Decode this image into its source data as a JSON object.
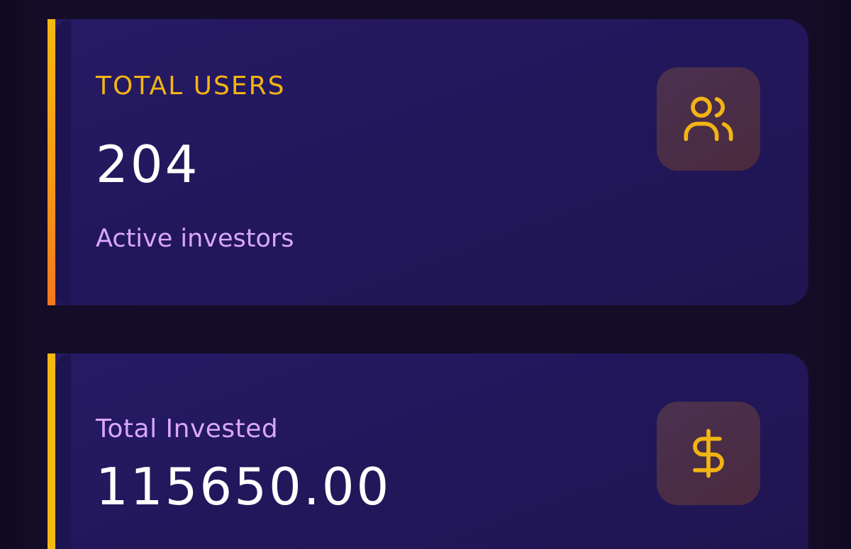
{
  "cards": {
    "users": {
      "title": "TOTAL USERS",
      "value": "204",
      "subtitle": "Active investors",
      "icon": "users-icon"
    },
    "invested": {
      "title": "Total Invested",
      "value": "115650.00",
      "icon": "dollar-icon"
    }
  },
  "colors": {
    "background": "#120a22",
    "card": "#22175b",
    "accent": "#f4b912",
    "subtitle": "#d9a6ff",
    "value": "#ffffff"
  }
}
